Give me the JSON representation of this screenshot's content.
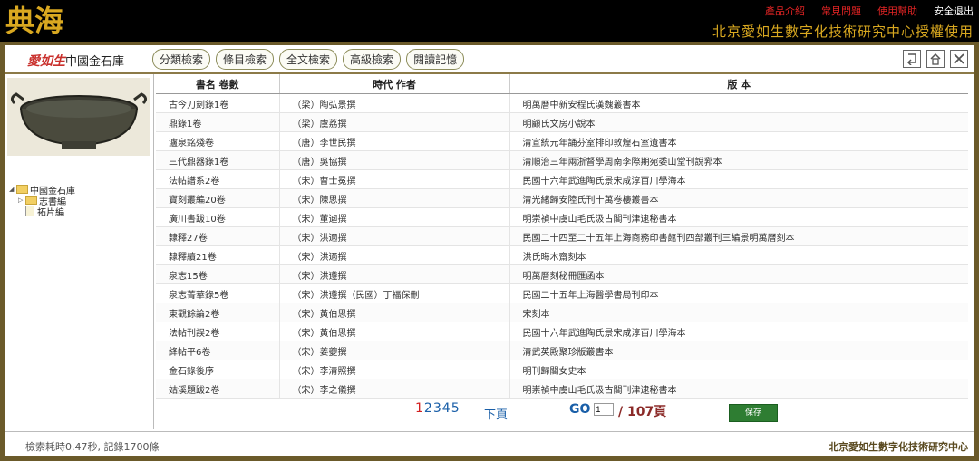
{
  "brand": {
    "logo_text": "典海",
    "accent": "#d9a820"
  },
  "top_links": [
    {
      "label": "產品介紹",
      "color": "#e22424"
    },
    {
      "label": "常見問題",
      "color": "#e22424"
    },
    {
      "label": "使用幫助",
      "color": "#e22424"
    },
    {
      "label": "安全退出",
      "color": "#ffffff"
    }
  ],
  "auth_title": "北京愛如生數字化技術研究中心授權使用",
  "db_brand": {
    "red": "愛如生",
    "label": "中國金石庫"
  },
  "tabs": [
    "分類檢索",
    "條目檢索",
    "全文檢索",
    "高級檢索",
    "閱讀記憶"
  ],
  "tree": {
    "root": "中國金石庫",
    "children": [
      "志書編",
      "拓片編"
    ]
  },
  "table": {
    "headers": [
      "書名 卷數",
      "時代 作者",
      "版 本"
    ],
    "rows": [
      [
        "古今刀劍錄1卷",
        "（梁）陶弘景撰",
        "明萬曆中新安程氏漢魏叢書本"
      ],
      [
        "鼎錄1卷",
        "（梁）虞荔撰",
        "明顧氏文房小說本"
      ],
      [
        "瀘泉銘殘卷",
        "（唐）李世民撰",
        "清宣統元年誦芬室排印敦煌石室遺書本"
      ],
      [
        "三代鼎器錄1卷",
        "（唐）吳協撰",
        "清順治三年兩浙督學周南李際期宛委山堂刊說郛本"
      ],
      [
        "法帖譜系2卷",
        "（宋）曹士冕撰",
        "民國十六年武進陶氏景宋咸淳百川學海本"
      ],
      [
        "寶刻叢編20卷",
        "（宋）陳思撰",
        "清光緒歸安陸氏刊十萬卷樓叢書本"
      ],
      [
        "廣川書跋10卷",
        "（宋）董逌撰",
        "明崇禎中虞山毛氏汲古閣刊津逮秘書本"
      ],
      [
        "隸釋27卷",
        "（宋）洪適撰",
        "民國二十四至二十五年上海商務印書館刊四部叢刊三編景明萬曆刻本"
      ],
      [
        "隸釋續21卷",
        "（宋）洪適撰",
        "洪氏晦木齋刻本"
      ],
      [
        "泉志15卷",
        "（宋）洪遵撰",
        "明萬曆刻秘冊匯函本"
      ],
      [
        "泉志菁華錄5卷",
        "（宋）洪遵撰（民國）丁福保刪",
        "民國二十五年上海醫學書局刊印本"
      ],
      [
        "東觀餘論2卷",
        "（宋）黃伯思撰",
        "宋刻本"
      ],
      [
        "法帖刊誤2卷",
        "（宋）黃伯思撰",
        "民國十六年武進陶氏景宋咸淳百川學海本"
      ],
      [
        "絳帖平6卷",
        "（宋）姜夔撰",
        "清武英殿聚珍版叢書本"
      ],
      [
        "金石錄後序",
        "（宋）李清照撰",
        "明刊歸閣女史本"
      ],
      [
        "姑溪題跋2卷",
        "（宋）李之儀撰",
        "明崇禎中虞山毛氏汲古閣刊津逮秘書本"
      ]
    ]
  },
  "pager": {
    "current": "1",
    "pages": [
      "2",
      "3",
      "4",
      "5"
    ],
    "next": "下頁",
    "go": "GO",
    "go_value": "1",
    "total": "/ 107頁",
    "save": "保存"
  },
  "status": "檢索耗時0.47秒, 記錄1700條",
  "footer": "北京愛如生數字化技術研究中心"
}
